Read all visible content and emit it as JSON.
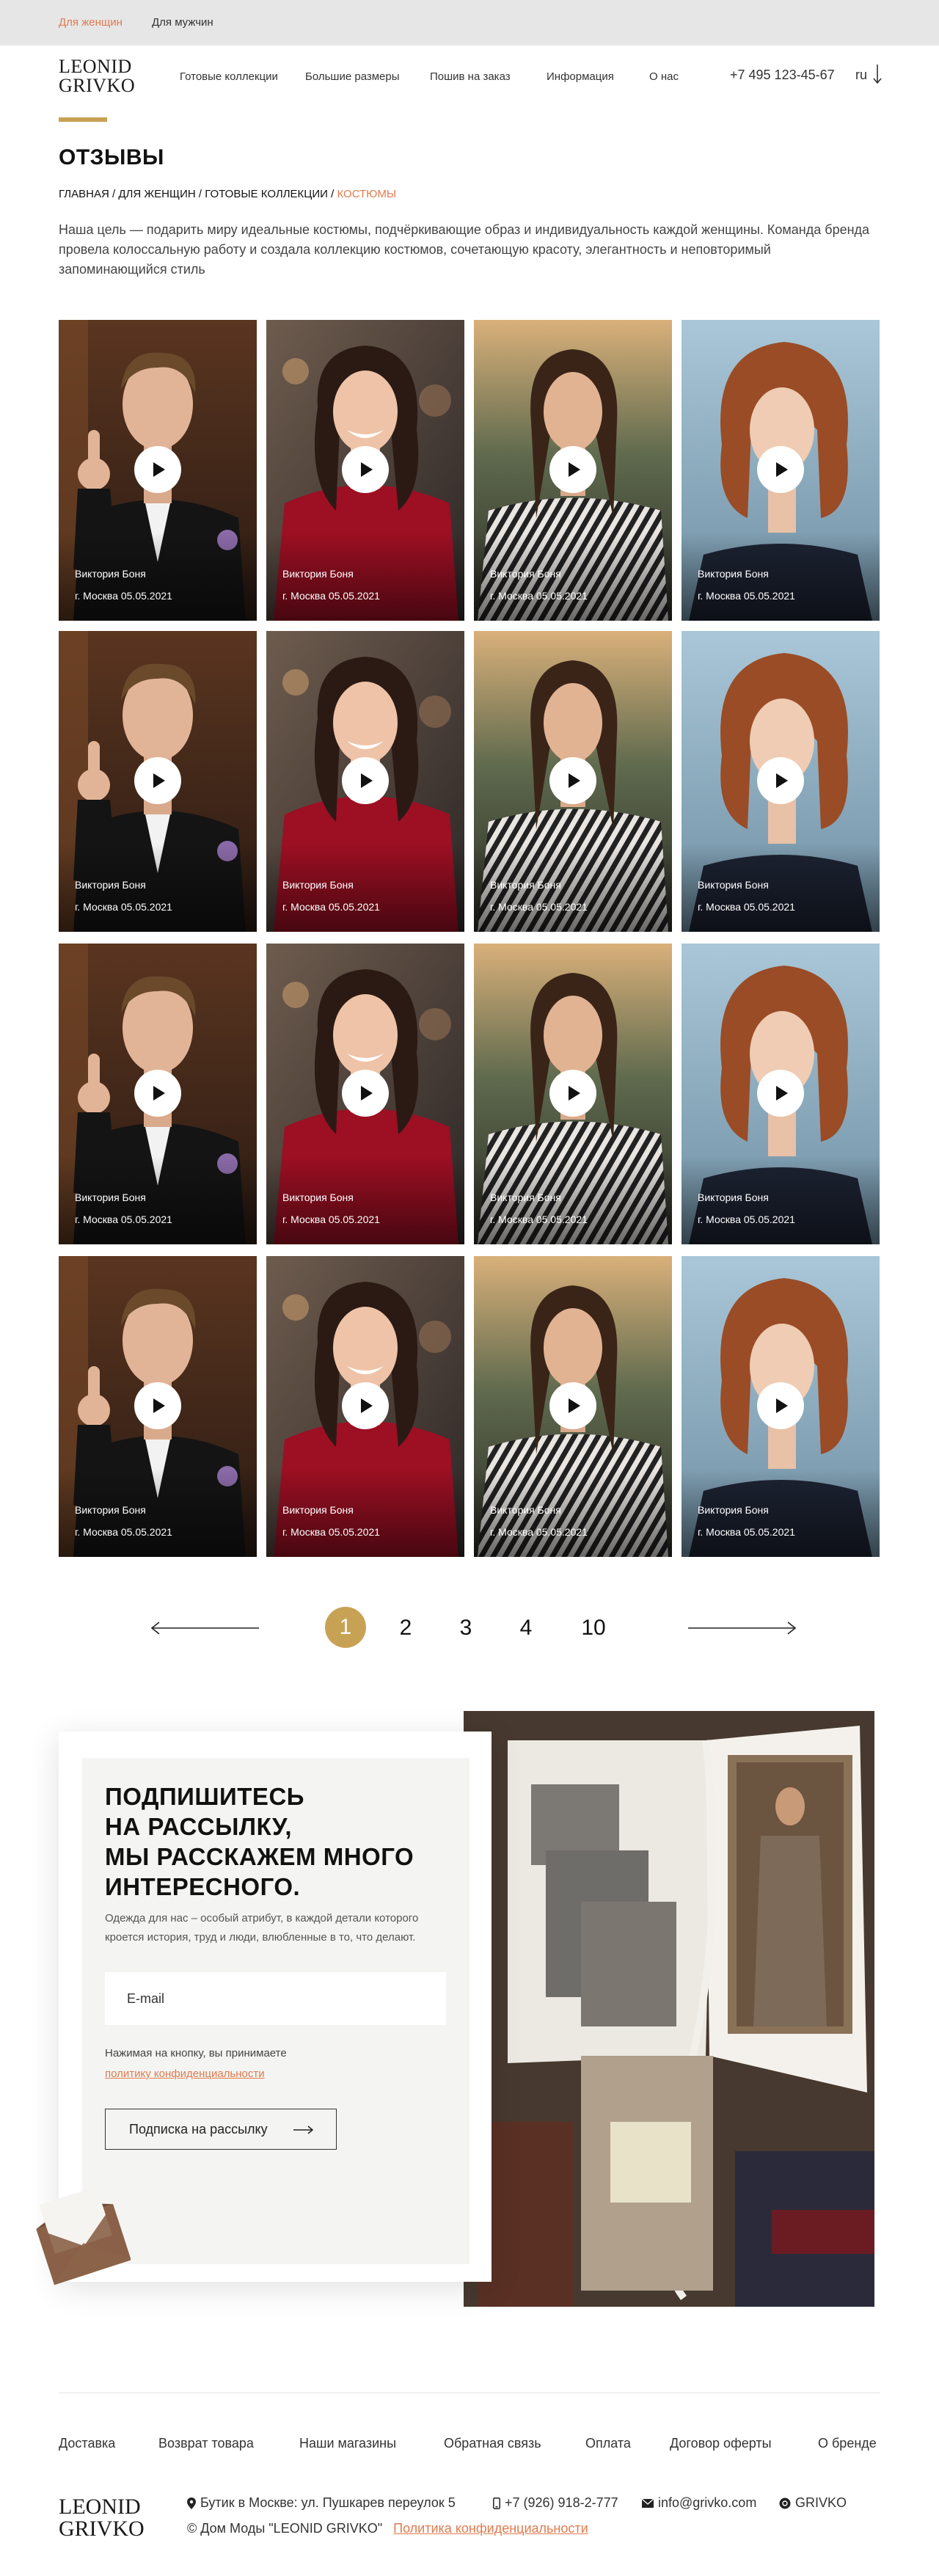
{
  "topbar": {
    "women": "Для женщин",
    "men": "Для мужчин"
  },
  "logo": {
    "line1": "LEONID",
    "line2": "GRIVKO"
  },
  "nav": [
    {
      "label": "Готовые коллекции"
    },
    {
      "label": "Большие размеры"
    },
    {
      "label": "Пошив на заказ"
    },
    {
      "label": "Информация"
    },
    {
      "label": "О нас"
    }
  ],
  "header": {
    "phone": "+7 495 123-45-67",
    "lang": "ru"
  },
  "page": {
    "title": "ОТЗЫВЫ",
    "breadcrumbs": [
      "ГЛАВНАЯ",
      "ДЛЯ ЖЕНЩИН",
      "ГОТОВЫЕ КОЛЛЕКЦИИ",
      "КОСТЮМЫ"
    ],
    "breadcrumb_sep": " / ",
    "intro": "Наша цель — подарить миру идеальные костюмы, подчёркивающие образ и индивидуальность каждой женщины. Команда бренда провела колоссальную работу и создала коллекцию костюмов, сочетающую красоту, элегантность и неповторимый запоминающийся стиль"
  },
  "reviews": {
    "name": "Виктория Боня",
    "meta": "г. Москва 05.05.2021",
    "photos": [
      "man-thumbs-up",
      "woman-red-dress",
      "woman-striped-shirt",
      "woman-red-hair"
    ],
    "rows": 4
  },
  "pagination": {
    "pages": [
      "1",
      "2",
      "3",
      "4",
      "10"
    ],
    "current": "1"
  },
  "subscribe": {
    "title_lines": [
      "ПОДПИШИТЕСЬ",
      "НА РАССЫЛКУ,",
      "МЫ РАССКАЖЕМ МНОГО",
      "ИНТЕРЕСНОГО."
    ],
    "text": "Одежда для нас – особый атрибут, в каждой детали которого кроется история, труд и люди, влюбленные в то, что делают.",
    "email_placeholder": "E-mail",
    "agree": "Нажимая на кнопку, вы принимаете",
    "policy": "политику конфиденциальности",
    "button": "Подписка на рассылку"
  },
  "footer": {
    "links": [
      "Доставка",
      "Возврат товара",
      "Наши магазины",
      "Обратная связь",
      "Оплата",
      "Договор оферты",
      "О бренде"
    ],
    "address": "Бутик в Москве: ул. Пушкарев переулок 5",
    "phone": "+7 (926) 918-2-777",
    "email": "info@grivko.com",
    "social": "GRIVKO",
    "copyright": "© Дом Моды \"LEONID GRIVKO\"",
    "policy": "Политика конфиденциальности"
  },
  "colors": {
    "accent": "#c8a254",
    "link": "#e07b4f"
  }
}
